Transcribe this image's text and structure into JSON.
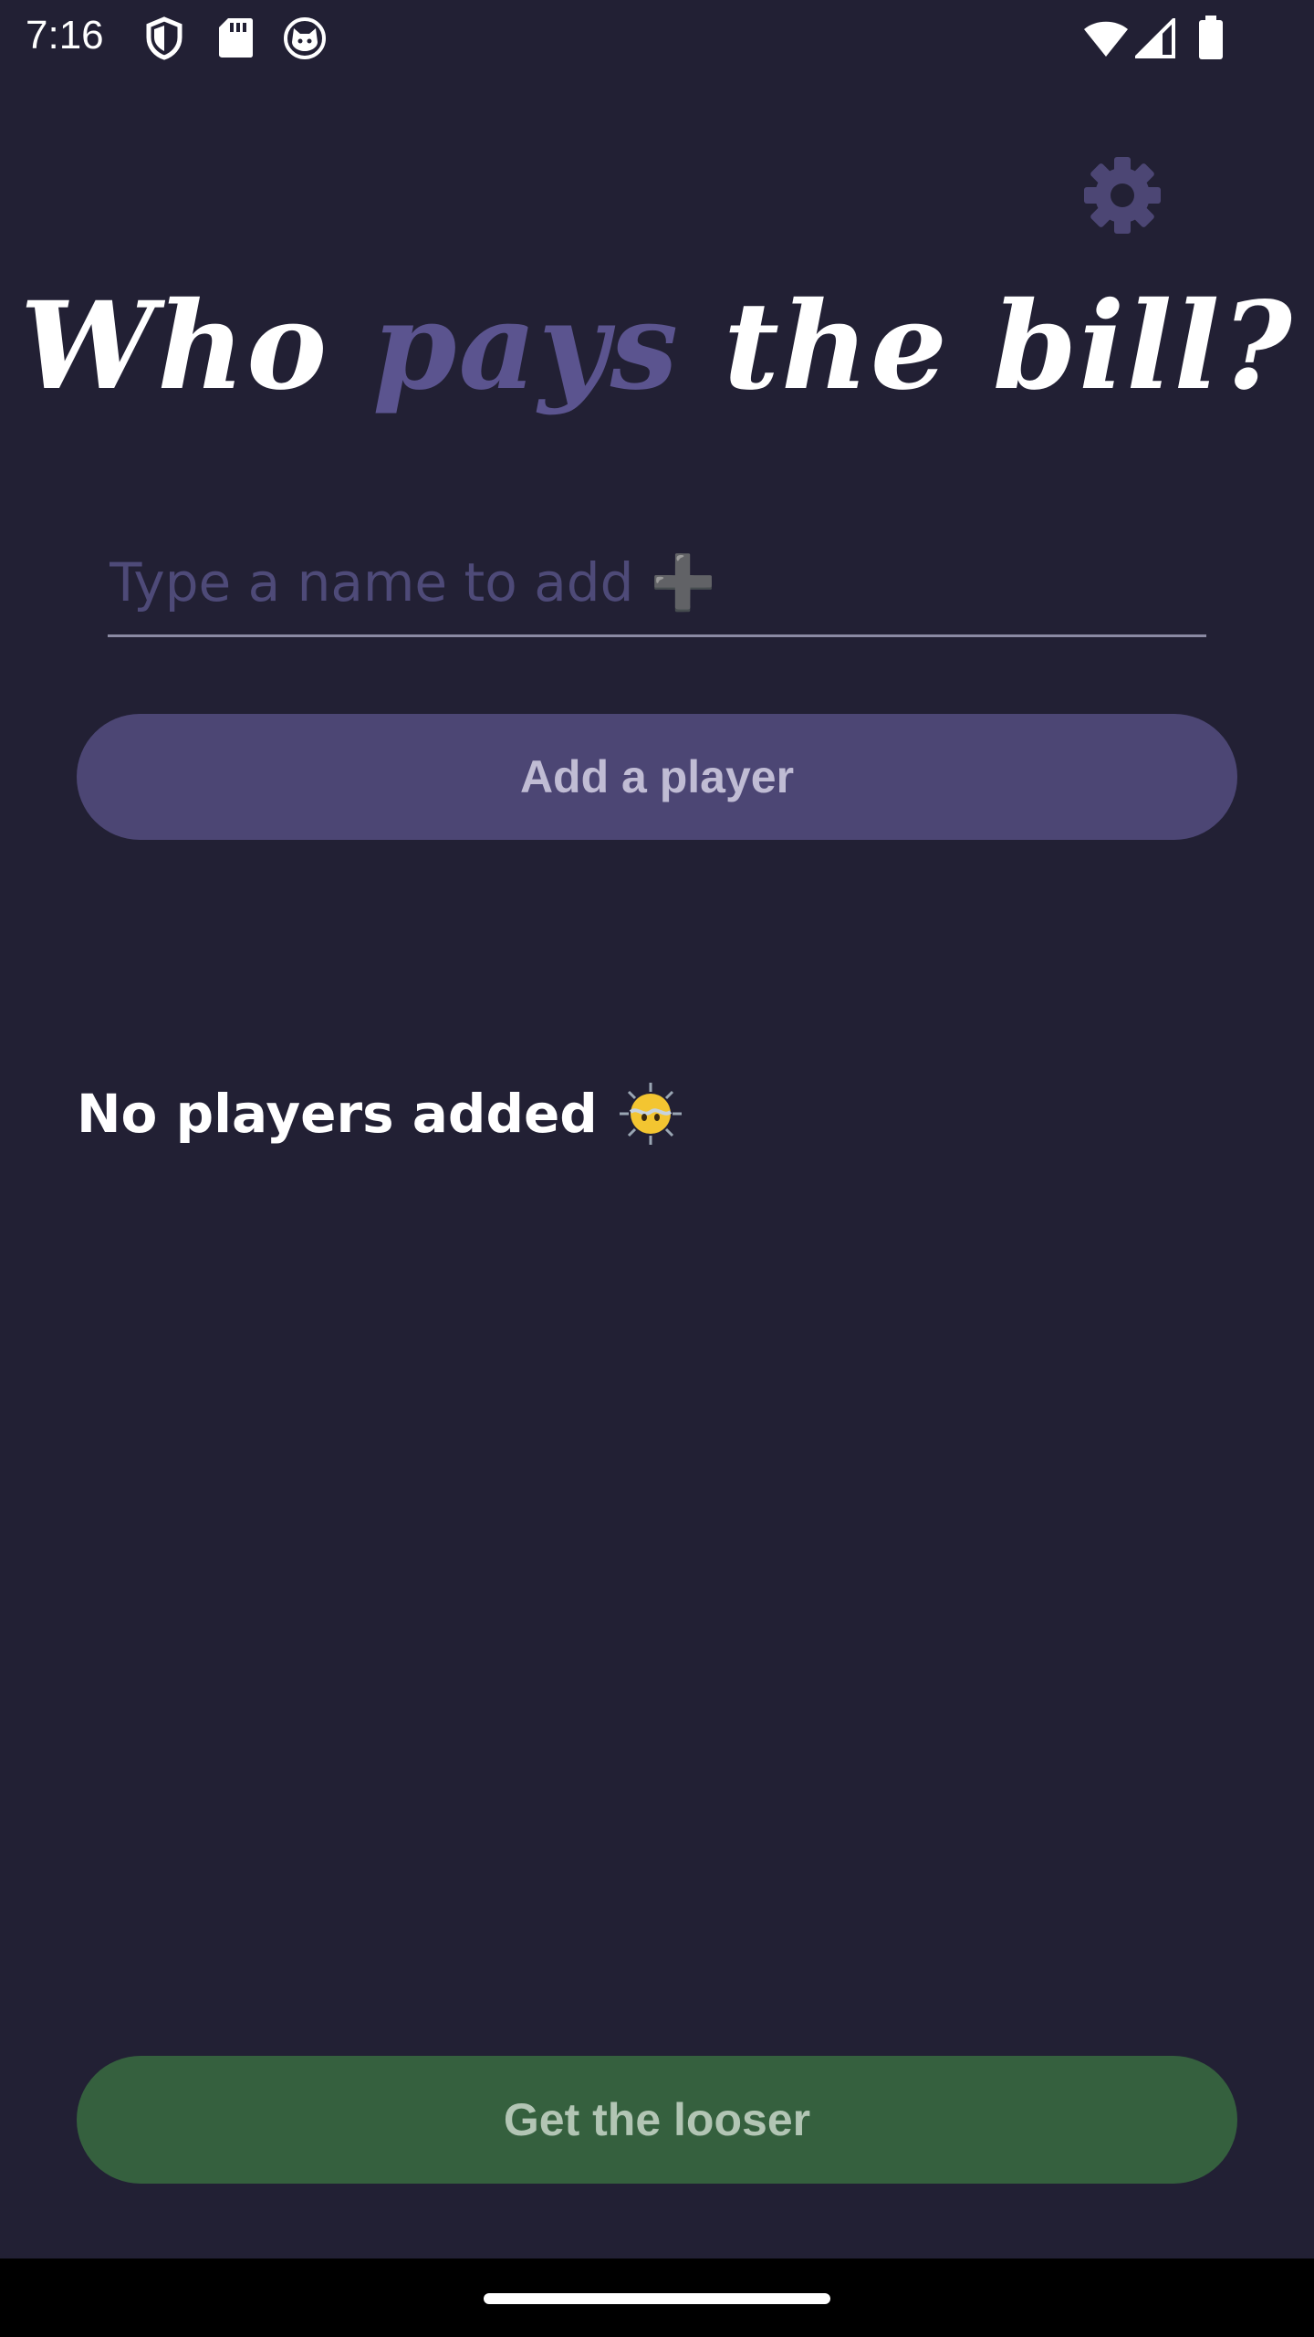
{
  "status_bar": {
    "time": "7:16",
    "icons": [
      "shield-icon",
      "sd-card-icon",
      "cat-face-icon",
      "wifi-icon",
      "cell-signal-icon",
      "battery-icon"
    ]
  },
  "header": {
    "settings_icon": "gear-icon",
    "title_part1": "Who ",
    "title_accent": "pays",
    "title_part2": " the bill?"
  },
  "input": {
    "placeholder": "Type a name to add ➕",
    "value": ""
  },
  "buttons": {
    "add_player": "Add a player",
    "get_looser": "Get the looser"
  },
  "players": {
    "empty_text": "No players added",
    "empty_icon": "dizzy-face-icon",
    "items": []
  },
  "colors": {
    "background": "#222034",
    "accent": "#5b548f",
    "add_button": "#4c4674",
    "get_button": "#35603e"
  }
}
